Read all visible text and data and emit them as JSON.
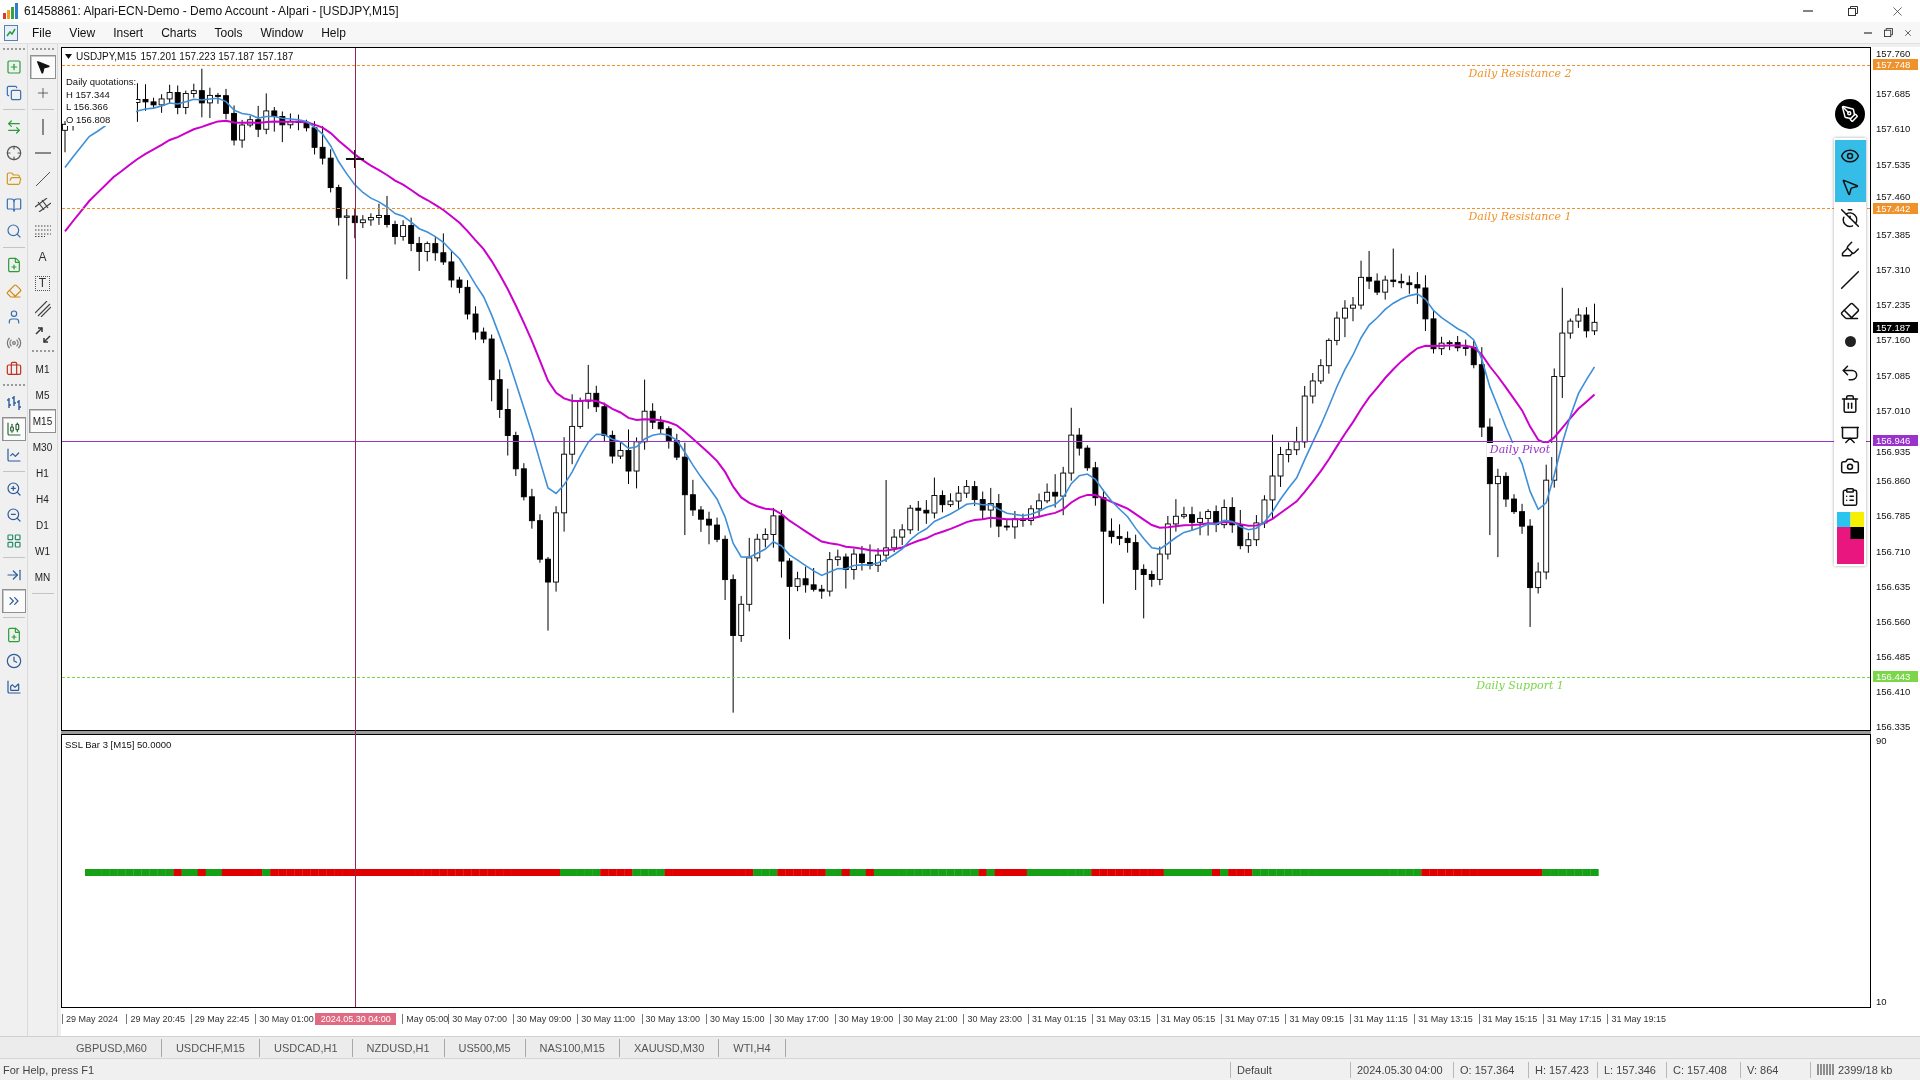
{
  "window": {
    "title": "61458861: Alpari-ECN-Demo - Demo Account - Alpari - [USDJPY,M15]"
  },
  "menu": [
    "File",
    "View",
    "Insert",
    "Charts",
    "Tools",
    "Window",
    "Help"
  ],
  "chart_style_buttons": [
    {
      "selected": false
    },
    {
      "selected": true
    },
    {
      "selected": false
    }
  ],
  "chart_scroll_buttons": [
    {
      "selected": false
    },
    {
      "selected": true
    }
  ],
  "drawing_tools": [
    {
      "selected": true
    },
    {
      "selected": false
    },
    {
      "selected": false
    },
    {
      "selected": false
    },
    {
      "selected": false
    },
    {
      "selected": false
    },
    {
      "selected": false
    },
    {
      "glyph": "A",
      "selected": false
    },
    {
      "glyph": "T",
      "selected": false
    },
    {
      "selected": false
    },
    {
      "selected": false
    }
  ],
  "timeframes": [
    {
      "label": "M1",
      "selected": false
    },
    {
      "label": "M5",
      "selected": false
    },
    {
      "label": "M15",
      "selected": true
    },
    {
      "label": "M30",
      "selected": false
    },
    {
      "label": "H1",
      "selected": false
    },
    {
      "label": "H4",
      "selected": false
    },
    {
      "label": "D1",
      "selected": false
    },
    {
      "label": "W1",
      "selected": false
    },
    {
      "label": "MN",
      "selected": false
    }
  ],
  "chart": {
    "symbol": "USDJPY,M15",
    "quotes": "157.201 157.223 157.187 157.187",
    "daily_quotations": {
      "title": "Daily quotations:",
      "lines": [
        "H 157.344",
        "L 156.366",
        "O 156.808"
      ]
    },
    "levels": [
      {
        "label": "Daily Resistance 2",
        "price": "157.748",
        "color": "#f0922b",
        "kind": "dashed"
      },
      {
        "label": "Daily Resistance 1",
        "price": "157.442",
        "color": "#f0922b",
        "kind": "dashed"
      },
      {
        "label": "Daily Pivot",
        "price": "156.946",
        "color": "#9933cc",
        "kind": "solid"
      },
      {
        "label": "Daily Support 1",
        "price": "156.443",
        "color": "#7bd64a",
        "kind": "dashed"
      }
    ],
    "current_price": "157.187",
    "price_axis": [
      "157.760",
      "157.685",
      "157.610",
      "157.535",
      "157.460",
      "157.385",
      "157.310",
      "157.235",
      "157.160",
      "157.085",
      "157.010",
      "156.935",
      "156.860",
      "156.785",
      "156.710",
      "156.635",
      "156.560",
      "156.485",
      "156.410",
      "156.335"
    ]
  },
  "screen_tools": [
    {
      "selected": true
    },
    {
      "selected": true
    },
    {
      "selected": false
    },
    {
      "selected": false
    },
    {
      "selected": false
    },
    {
      "selected": false
    },
    {
      "selected": false
    },
    {
      "selected": false
    },
    {
      "selected": false
    },
    {
      "selected": false
    },
    {
      "selected": false
    },
    {
      "selected": false
    }
  ],
  "indicator": {
    "title": "SSL Bar 3 [M15] 50.0000",
    "scale": [
      "90",
      "10"
    ]
  },
  "time_axis": [
    {
      "kind": "label",
      "text": "29 May 2024"
    },
    {
      "kind": "label",
      "text": "29 May 20:45"
    },
    {
      "kind": "label",
      "text": "29 May 22:45"
    },
    {
      "kind": "label",
      "text": "30 May 01:00"
    },
    {
      "kind": "cursor",
      "text": "2024.05.30 04:00"
    },
    {
      "kind": "label",
      "text": "May 05:00"
    },
    {
      "kind": "label",
      "text": "30 May 07:00"
    },
    {
      "kind": "label",
      "text": "30 May 09:00"
    },
    {
      "kind": "label",
      "text": "30 May 11:00"
    },
    {
      "kind": "label",
      "text": "30 May 13:00"
    },
    {
      "kind": "label",
      "text": "30 May 15:00"
    },
    {
      "kind": "label",
      "text": "30 May 17:00"
    },
    {
      "kind": "label",
      "text": "30 May 19:00"
    },
    {
      "kind": "label",
      "text": "30 May 21:00"
    },
    {
      "kind": "label",
      "text": "30 May 23:00"
    },
    {
      "kind": "label",
      "text": "31 May 01:15"
    },
    {
      "kind": "label",
      "text": "31 May 03:15"
    },
    {
      "kind": "label",
      "text": "31 May 05:15"
    },
    {
      "kind": "label",
      "text": "31 May 07:15"
    },
    {
      "kind": "label",
      "text": "31 May 09:15"
    },
    {
      "kind": "label",
      "text": "31 May 11:15"
    },
    {
      "kind": "label",
      "text": "31 May 13:15"
    },
    {
      "kind": "label",
      "text": "31 May 15:15"
    },
    {
      "kind": "label",
      "text": "31 May 17:15"
    },
    {
      "kind": "label",
      "text": "31 May 19:15"
    }
  ],
  "symbol_tabs": [
    {
      "label": "GBPUSD,M60",
      "selected": false
    },
    {
      "label": "USDCHF,M15",
      "selected": false
    },
    {
      "label": "USDCAD,H1",
      "selected": false
    },
    {
      "label": "NZDUSD,H1",
      "selected": false
    },
    {
      "label": "US500,M5",
      "selected": false
    },
    {
      "label": "NAS100,M15",
      "selected": false
    },
    {
      "label": "XAUUSD,M30",
      "selected": false
    },
    {
      "label": "WTI,H4",
      "selected": false
    }
  ],
  "status_bar": {
    "help": "For Help, press F1",
    "cells": [
      "Default",
      "2024.05.30 04:00",
      "O: 157.364",
      "H: 157.423",
      "L: 157.346",
      "C: 157.408",
      "V: 864",
      "2399/18 kb"
    ]
  }
}
